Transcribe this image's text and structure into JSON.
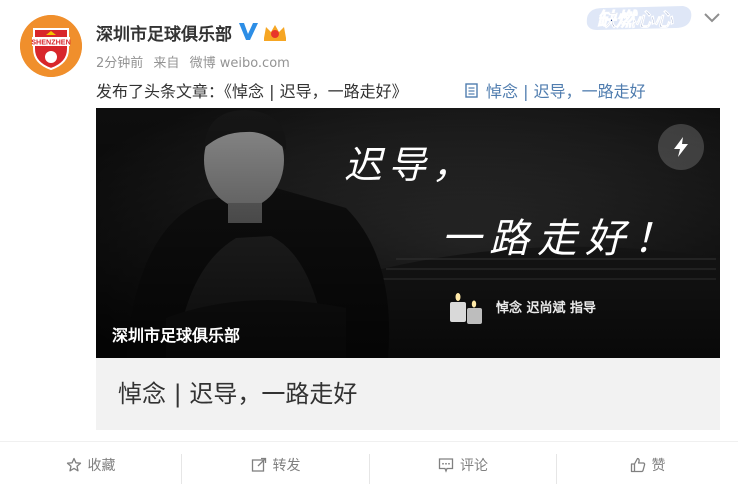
{
  "header": {
    "username": "深圳市足球俱乐部",
    "time_ago": "2分钟前",
    "source_prefix": "来自",
    "source_name": "微博 weibo.com",
    "badge_text": "缺燃心心",
    "avatar_text": "SHENZHEN"
  },
  "post": {
    "text": "发布了头条文章：《悼念 | 迟导，一路走好》",
    "article_link": "悼念 | 迟导，一路走好"
  },
  "card": {
    "headline_line1": "迟导，",
    "headline_line2": "一路走好！",
    "memorial_text": "悼念  迟尚斌  指导",
    "club_label": "深圳市足球俱乐部",
    "title": "悼念 | 迟导，一路走好"
  },
  "actions": {
    "favorite": "收藏",
    "repost": "转发",
    "comment": "评论",
    "like": "赞"
  },
  "colors": {
    "link": "#507daf",
    "avatar_orange": "#f08f2c",
    "verified_blue": "#2d8ee6",
    "muted": "#939393"
  }
}
